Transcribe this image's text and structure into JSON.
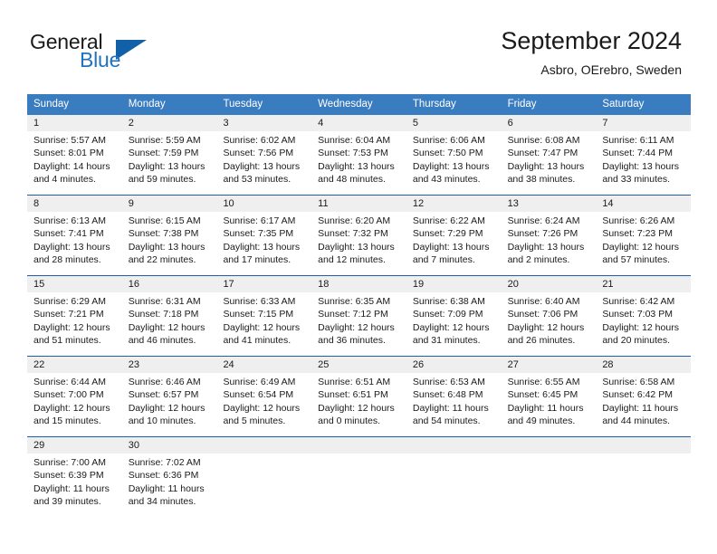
{
  "brand": {
    "word_one": "General",
    "word_two": "Blue",
    "triangle_icon": "triangle-icon"
  },
  "header": {
    "title": "September 2024",
    "subtitle": "Asbro, OErebro, Sweden"
  },
  "colors": {
    "header_blue": "#3a7cc0",
    "row_divider_blue": "#1f5fa8",
    "day_number_band": "#efeff0",
    "brand_blue": "#1f72bd",
    "triangle_blue": "#1260a8",
    "text": "#1a1a1a"
  },
  "weekdays": [
    "Sunday",
    "Monday",
    "Tuesday",
    "Wednesday",
    "Thursday",
    "Friday",
    "Saturday"
  ],
  "weeks": [
    [
      {
        "day": "1",
        "lines": [
          "Sunrise: 5:57 AM",
          "Sunset: 8:01 PM",
          "Daylight: 14 hours",
          "and 4 minutes."
        ]
      },
      {
        "day": "2",
        "lines": [
          "Sunrise: 5:59 AM",
          "Sunset: 7:59 PM",
          "Daylight: 13 hours",
          "and 59 minutes."
        ]
      },
      {
        "day": "3",
        "lines": [
          "Sunrise: 6:02 AM",
          "Sunset: 7:56 PM",
          "Daylight: 13 hours",
          "and 53 minutes."
        ]
      },
      {
        "day": "4",
        "lines": [
          "Sunrise: 6:04 AM",
          "Sunset: 7:53 PM",
          "Daylight: 13 hours",
          "and 48 minutes."
        ]
      },
      {
        "day": "5",
        "lines": [
          "Sunrise: 6:06 AM",
          "Sunset: 7:50 PM",
          "Daylight: 13 hours",
          "and 43 minutes."
        ]
      },
      {
        "day": "6",
        "lines": [
          "Sunrise: 6:08 AM",
          "Sunset: 7:47 PM",
          "Daylight: 13 hours",
          "and 38 minutes."
        ]
      },
      {
        "day": "7",
        "lines": [
          "Sunrise: 6:11 AM",
          "Sunset: 7:44 PM",
          "Daylight: 13 hours",
          "and 33 minutes."
        ]
      }
    ],
    [
      {
        "day": "8",
        "lines": [
          "Sunrise: 6:13 AM",
          "Sunset: 7:41 PM",
          "Daylight: 13 hours",
          "and 28 minutes."
        ]
      },
      {
        "day": "9",
        "lines": [
          "Sunrise: 6:15 AM",
          "Sunset: 7:38 PM",
          "Daylight: 13 hours",
          "and 22 minutes."
        ]
      },
      {
        "day": "10",
        "lines": [
          "Sunrise: 6:17 AM",
          "Sunset: 7:35 PM",
          "Daylight: 13 hours",
          "and 17 minutes."
        ]
      },
      {
        "day": "11",
        "lines": [
          "Sunrise: 6:20 AM",
          "Sunset: 7:32 PM",
          "Daylight: 13 hours",
          "and 12 minutes."
        ]
      },
      {
        "day": "12",
        "lines": [
          "Sunrise: 6:22 AM",
          "Sunset: 7:29 PM",
          "Daylight: 13 hours",
          "and 7 minutes."
        ]
      },
      {
        "day": "13",
        "lines": [
          "Sunrise: 6:24 AM",
          "Sunset: 7:26 PM",
          "Daylight: 13 hours",
          "and 2 minutes."
        ]
      },
      {
        "day": "14",
        "lines": [
          "Sunrise: 6:26 AM",
          "Sunset: 7:23 PM",
          "Daylight: 12 hours",
          "and 57 minutes."
        ]
      }
    ],
    [
      {
        "day": "15",
        "lines": [
          "Sunrise: 6:29 AM",
          "Sunset: 7:21 PM",
          "Daylight: 12 hours",
          "and 51 minutes."
        ]
      },
      {
        "day": "16",
        "lines": [
          "Sunrise: 6:31 AM",
          "Sunset: 7:18 PM",
          "Daylight: 12 hours",
          "and 46 minutes."
        ]
      },
      {
        "day": "17",
        "lines": [
          "Sunrise: 6:33 AM",
          "Sunset: 7:15 PM",
          "Daylight: 12 hours",
          "and 41 minutes."
        ]
      },
      {
        "day": "18",
        "lines": [
          "Sunrise: 6:35 AM",
          "Sunset: 7:12 PM",
          "Daylight: 12 hours",
          "and 36 minutes."
        ]
      },
      {
        "day": "19",
        "lines": [
          "Sunrise: 6:38 AM",
          "Sunset: 7:09 PM",
          "Daylight: 12 hours",
          "and 31 minutes."
        ]
      },
      {
        "day": "20",
        "lines": [
          "Sunrise: 6:40 AM",
          "Sunset: 7:06 PM",
          "Daylight: 12 hours",
          "and 26 minutes."
        ]
      },
      {
        "day": "21",
        "lines": [
          "Sunrise: 6:42 AM",
          "Sunset: 7:03 PM",
          "Daylight: 12 hours",
          "and 20 minutes."
        ]
      }
    ],
    [
      {
        "day": "22",
        "lines": [
          "Sunrise: 6:44 AM",
          "Sunset: 7:00 PM",
          "Daylight: 12 hours",
          "and 15 minutes."
        ]
      },
      {
        "day": "23",
        "lines": [
          "Sunrise: 6:46 AM",
          "Sunset: 6:57 PM",
          "Daylight: 12 hours",
          "and 10 minutes."
        ]
      },
      {
        "day": "24",
        "lines": [
          "Sunrise: 6:49 AM",
          "Sunset: 6:54 PM",
          "Daylight: 12 hours",
          "and 5 minutes."
        ]
      },
      {
        "day": "25",
        "lines": [
          "Sunrise: 6:51 AM",
          "Sunset: 6:51 PM",
          "Daylight: 12 hours",
          "and 0 minutes."
        ]
      },
      {
        "day": "26",
        "lines": [
          "Sunrise: 6:53 AM",
          "Sunset: 6:48 PM",
          "Daylight: 11 hours",
          "and 54 minutes."
        ]
      },
      {
        "day": "27",
        "lines": [
          "Sunrise: 6:55 AM",
          "Sunset: 6:45 PM",
          "Daylight: 11 hours",
          "and 49 minutes."
        ]
      },
      {
        "day": "28",
        "lines": [
          "Sunrise: 6:58 AM",
          "Sunset: 6:42 PM",
          "Daylight: 11 hours",
          "and 44 minutes."
        ]
      }
    ],
    [
      {
        "day": "29",
        "lines": [
          "Sunrise: 7:00 AM",
          "Sunset: 6:39 PM",
          "Daylight: 11 hours",
          "and 39 minutes."
        ]
      },
      {
        "day": "30",
        "lines": [
          "Sunrise: 7:02 AM",
          "Sunset: 6:36 PM",
          "Daylight: 11 hours",
          "and 34 minutes."
        ]
      },
      {
        "day": "",
        "lines": []
      },
      {
        "day": "",
        "lines": []
      },
      {
        "day": "",
        "lines": []
      },
      {
        "day": "",
        "lines": []
      },
      {
        "day": "",
        "lines": []
      }
    ]
  ]
}
